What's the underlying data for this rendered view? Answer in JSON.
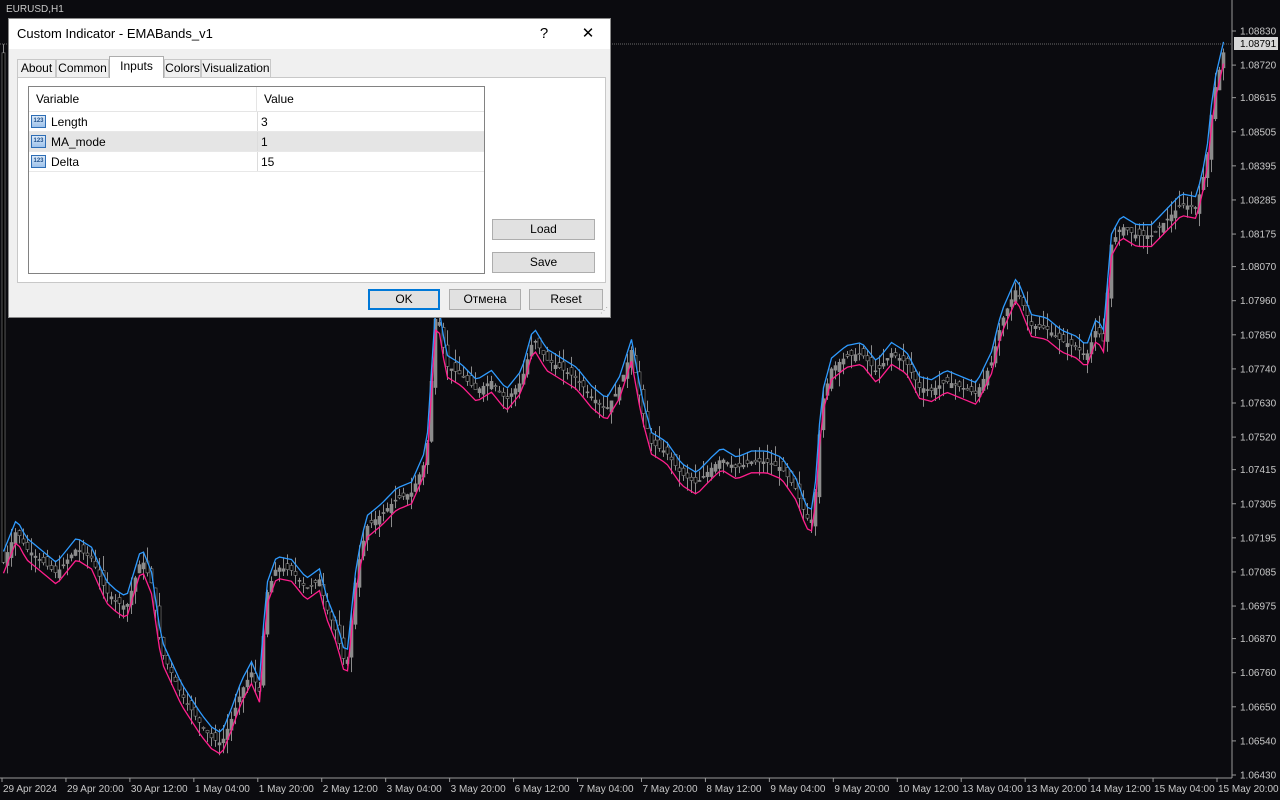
{
  "symbol": "EURUSD,H1",
  "dialog": {
    "title": "Custom Indicator - EMABands_v1",
    "help_label": "?",
    "close_label": "✕",
    "tabs": [
      "About",
      "Common",
      "Inputs",
      "Colors",
      "Visualization"
    ],
    "active_tab": "Inputs",
    "table": {
      "headers": [
        "Variable",
        "Value"
      ],
      "rows": [
        {
          "name": "Length",
          "value": "3",
          "icon": "int-123-icon"
        },
        {
          "name": "MA_mode",
          "value": "1",
          "icon": "int-123-icon"
        },
        {
          "name": "Delta",
          "value": "15",
          "icon": "int-123-icon"
        }
      ],
      "selected_row": 1
    },
    "load_label": "Load",
    "save_label": "Save",
    "ok_label": "OK",
    "cancel_label": "Отмена",
    "reset_label": "Reset"
  },
  "chart_data": {
    "type": "candlestick",
    "symbol": "EURUSD",
    "timeframe": "H1",
    "current_price": "1.08791",
    "price_ticks": [
      "1.08830",
      "1.08720",
      "1.08615",
      "1.08505",
      "1.08395",
      "1.08285",
      "1.08175",
      "1.08070",
      "1.07960",
      "1.07850",
      "1.07740",
      "1.07630",
      "1.07520",
      "1.07415",
      "1.07305",
      "1.07195",
      "1.07085",
      "1.06975",
      "1.06870",
      "1.06760",
      "1.06650",
      "1.06540",
      "1.06430"
    ],
    "time_ticks": [
      "29 Apr 2024",
      "29 Apr 20:00",
      "30 Apr 12:00",
      "1 May 04:00",
      "1 May 20:00",
      "2 May 12:00",
      "3 May 04:00",
      "3 May 20:00",
      "6 May 12:00",
      "7 May 04:00",
      "7 May 20:00",
      "8 May 12:00",
      "9 May 04:00",
      "9 May 20:00",
      "10 May 12:00",
      "13 May 04:00",
      "13 May 20:00",
      "14 May 12:00",
      "15 May 04:00",
      "15 May 20:00"
    ],
    "close_path": [
      [
        0,
        1.071
      ],
      [
        15,
        1.0722
      ],
      [
        25,
        1.0716
      ],
      [
        40,
        1.0712
      ],
      [
        55,
        1.0708
      ],
      [
        75,
        1.0716
      ],
      [
        90,
        1.0713
      ],
      [
        105,
        1.0702
      ],
      [
        115,
        1.0699
      ],
      [
        125,
        1.0697
      ],
      [
        140,
        1.0713
      ],
      [
        150,
        1.0705
      ],
      [
        160,
        1.0683
      ],
      [
        170,
        1.0676
      ],
      [
        180,
        1.0669
      ],
      [
        190,
        1.0664
      ],
      [
        200,
        1.0659
      ],
      [
        210,
        1.0655
      ],
      [
        220,
        1.0653
      ],
      [
        230,
        1.0661
      ],
      [
        240,
        1.067
      ],
      [
        250,
        1.0676
      ],
      [
        258,
        1.067
      ],
      [
        265,
        1.0701
      ],
      [
        275,
        1.071
      ],
      [
        290,
        1.0709
      ],
      [
        305,
        1.0703
      ],
      [
        318,
        1.0706
      ],
      [
        325,
        1.0697
      ],
      [
        335,
        1.0689
      ],
      [
        345,
        1.0677
      ],
      [
        355,
        1.0708
      ],
      [
        365,
        1.0723
      ],
      [
        380,
        1.0727
      ],
      [
        395,
        1.0732
      ],
      [
        410,
        1.0734
      ],
      [
        425,
        1.0745
      ],
      [
        435,
        1.0795
      ],
      [
        445,
        1.0775
      ],
      [
        460,
        1.0772
      ],
      [
        475,
        1.0767
      ],
      [
        490,
        1.077
      ],
      [
        505,
        1.0764
      ],
      [
        520,
        1.077
      ],
      [
        532,
        1.0784
      ],
      [
        545,
        1.0777
      ],
      [
        560,
        1.0774
      ],
      [
        575,
        1.0771
      ],
      [
        590,
        1.0765
      ],
      [
        605,
        1.0761
      ],
      [
        618,
        1.0768
      ],
      [
        630,
        1.078
      ],
      [
        640,
        1.0762
      ],
      [
        650,
        1.075
      ],
      [
        665,
        1.0747
      ],
      [
        680,
        1.074
      ],
      [
        695,
        1.0737
      ],
      [
        710,
        1.0742
      ],
      [
        720,
        1.0745
      ],
      [
        735,
        1.0742
      ],
      [
        750,
        1.0744
      ],
      [
        765,
        1.0744
      ],
      [
        780,
        1.0742
      ],
      [
        795,
        1.0735
      ],
      [
        805,
        1.0726
      ],
      [
        812,
        1.0725
      ],
      [
        820,
        1.0762
      ],
      [
        830,
        1.0774
      ],
      [
        845,
        1.0778
      ],
      [
        860,
        1.0779
      ],
      [
        875,
        1.0773
      ],
      [
        890,
        1.0779
      ],
      [
        905,
        1.0776
      ],
      [
        918,
        1.0768
      ],
      [
        930,
        1.0767
      ],
      [
        945,
        1.077
      ],
      [
        960,
        1.0768
      ],
      [
        975,
        1.0766
      ],
      [
        990,
        1.0776
      ],
      [
        1000,
        1.0789
      ],
      [
        1015,
        1.08
      ],
      [
        1030,
        1.0788
      ],
      [
        1045,
        1.0787
      ],
      [
        1060,
        1.0783
      ],
      [
        1075,
        1.0781
      ],
      [
        1085,
        1.0778
      ],
      [
        1095,
        1.0787
      ],
      [
        1102,
        1.0783
      ],
      [
        1110,
        1.0814
      ],
      [
        1120,
        1.082
      ],
      [
        1135,
        1.0817
      ],
      [
        1150,
        1.0817
      ],
      [
        1165,
        1.0822
      ],
      [
        1180,
        1.0827
      ],
      [
        1195,
        1.0826
      ],
      [
        1205,
        1.084
      ],
      [
        1212,
        1.0862
      ],
      [
        1222,
        1.0876
      ]
    ],
    "series": [
      {
        "name": "Upper band",
        "color": "#2f9bff"
      },
      {
        "name": "Lower band",
        "color": "#ff1e8c"
      }
    ]
  }
}
